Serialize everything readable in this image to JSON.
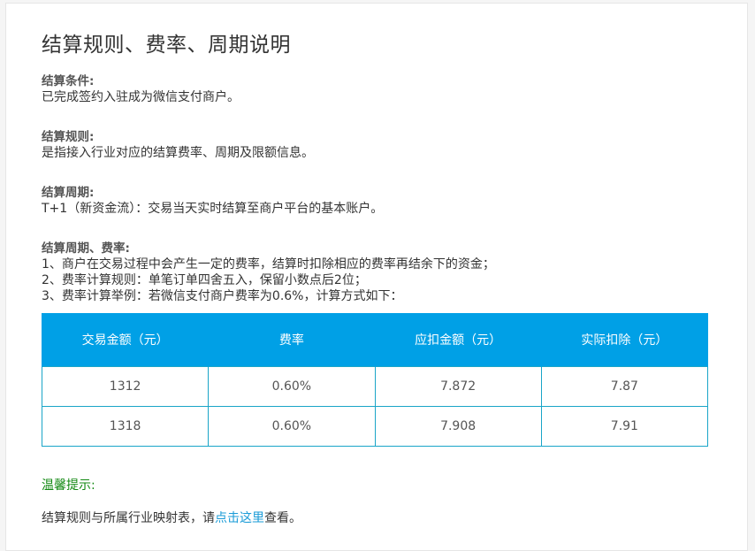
{
  "title": "结算规则、费率、周期说明",
  "sections": [
    {
      "heading": "结算条件:",
      "lines": [
        "已完成签约入驻成为微信支付商户。"
      ]
    },
    {
      "heading": "结算规则:",
      "lines": [
        "是指接入行业对应的结算费率、周期及限额信息。"
      ]
    },
    {
      "heading": "结算周期:",
      "lines": [
        "T+1（新资金流）：交易当天实时结算至商户平台的基本账户。"
      ]
    },
    {
      "heading": "结算周期、费率:",
      "lines": [
        "1、商户在交易过程中会产生一定的费率，结算时扣除相应的费率再结余下的资金；",
        "2、费率计算规则：单笔订单四舍五入，保留小数点后2位；",
        "3、费率计算举例：若微信支付商户费率为0.6%，计算方式如下："
      ]
    }
  ],
  "table": {
    "headers": [
      "交易金额（元）",
      "费率",
      "应扣金额（元）",
      "实际扣除（元）"
    ],
    "rows": [
      [
        "1312",
        "0.60%",
        "7.872",
        "7.87"
      ],
      [
        "1318",
        "0.60%",
        "7.908",
        "7.91"
      ]
    ]
  },
  "tip": {
    "title": "温馨提示:",
    "text_before": "结算规则与所属行业映射表，请",
    "link_text": "点击这里",
    "text_after": "查看。"
  },
  "colors": {
    "table_header_bg": "#00a0e6",
    "table_border": "#1aa5c8",
    "tip_title": "#118811",
    "link": "#1a9bd7"
  }
}
